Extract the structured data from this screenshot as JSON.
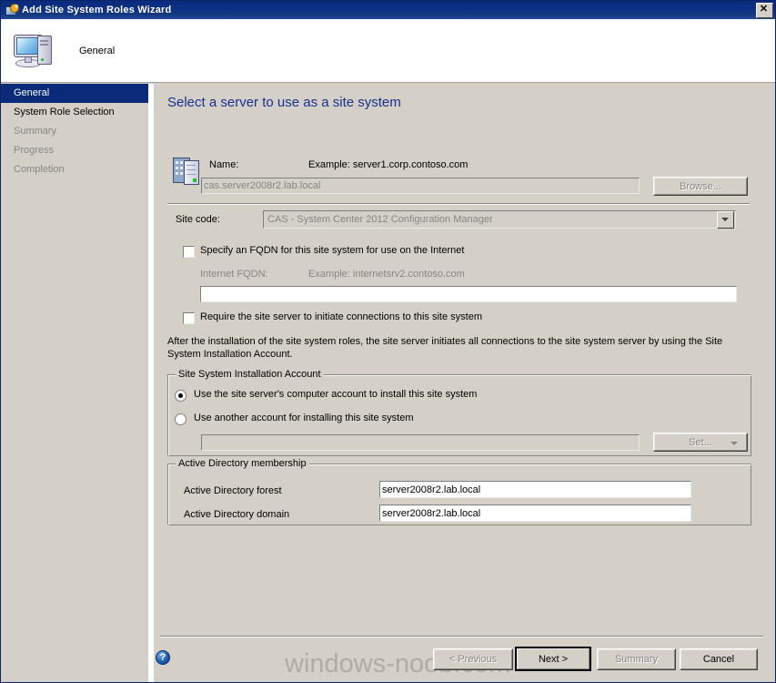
{
  "window": {
    "title": "Add Site System Roles Wizard",
    "close_label": "✕",
    "icon": "wizard-icon"
  },
  "header": {
    "step_label": "General",
    "icon": "computer-icon"
  },
  "sidebar": {
    "items": [
      {
        "label": "General",
        "state": "active"
      },
      {
        "label": "System Role Selection",
        "state": "enabled"
      },
      {
        "label": "Summary",
        "state": "disabled"
      },
      {
        "label": "Progress",
        "state": "disabled"
      },
      {
        "label": "Completion",
        "state": "disabled"
      }
    ]
  },
  "main": {
    "heading": "Select a server to use as a site system",
    "server_icon": "server-icon",
    "name_label": "Name:",
    "name_example": "Example: server1.corp.contoso.com",
    "name_value": "cas.server2008r2.lab.local",
    "browse_label": "Browse...",
    "site_code_label": "Site code:",
    "site_code_value": "CAS - System Center 2012 Configuration Manager",
    "fqdn_checkbox_label": "Specify an FQDN for this site system for use on the Internet",
    "fqdn_checked": false,
    "internet_fqdn_label": "Internet FQDN:",
    "internet_fqdn_example": "Example: internetsrv2.contoso.com",
    "internet_fqdn_value": "",
    "require_checkbox_label": "Require the site server to initiate connections to this site system",
    "require_checked": false,
    "description": "After the  installation of the site system roles, the site server initiates all connections to the site system server by using the Site System Installation Account.",
    "install_account_group": {
      "title": "Site System Installation Account",
      "option_computer_account": "Use the site server's computer account to install this site system",
      "option_another_account": "Use another account for installing this site system",
      "selected": "computer_account",
      "account_value": "",
      "set_button_label": "Set..."
    },
    "ad_group": {
      "title": "Active Directory membership",
      "forest_label": "Active Directory forest",
      "forest_value": "server2008r2.lab.local",
      "domain_label": "Active Directory domain",
      "domain_value": "server2008r2.lab.local"
    }
  },
  "footer": {
    "help_icon_glyph": "?",
    "previous_label": "< Previous",
    "next_label": "Next >",
    "summary_label": "Summary",
    "cancel_label": "Cancel",
    "watermark": "windows-noob.com"
  },
  "colors": {
    "titlebar_blue": "#0a2b7a",
    "heading_blue": "#1b2f8f",
    "dialog_face": "#d4d0c8",
    "disabled_text": "#868686"
  }
}
